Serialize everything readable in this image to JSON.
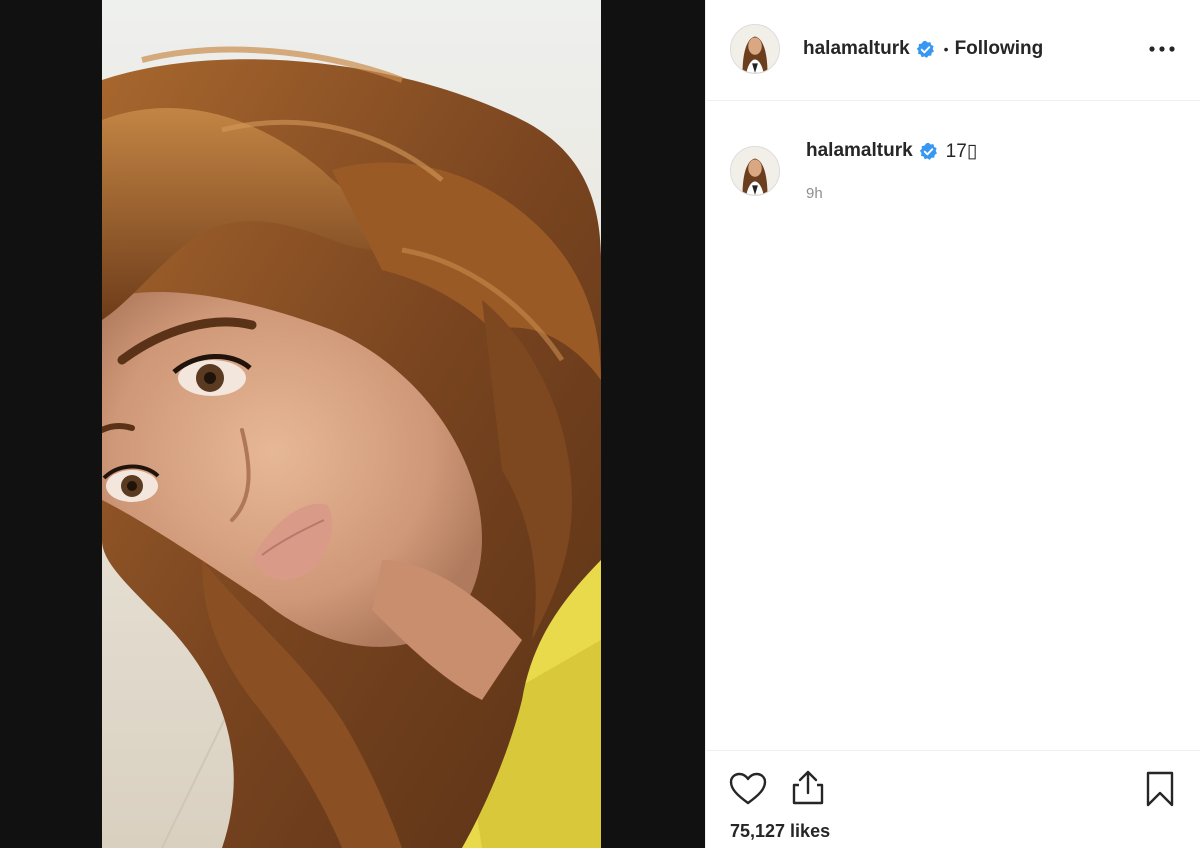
{
  "post": {
    "username": "halamalturk",
    "verified": true,
    "follow_separator": "•",
    "follow_status": "Following",
    "caption": "17",
    "caption_emoji": "▯",
    "time_ago": "9h",
    "likes": "75,127 likes"
  },
  "icons": {
    "verified": "verified-badge-icon",
    "more": "more-options-icon",
    "like": "heart-icon",
    "share": "share-icon",
    "save": "bookmark-icon"
  },
  "colors": {
    "verified_blue": "#3897f0",
    "text": "#262626",
    "secondary_text": "#8e8e8e",
    "divider": "#efefef",
    "media_backdrop": "#111111"
  }
}
